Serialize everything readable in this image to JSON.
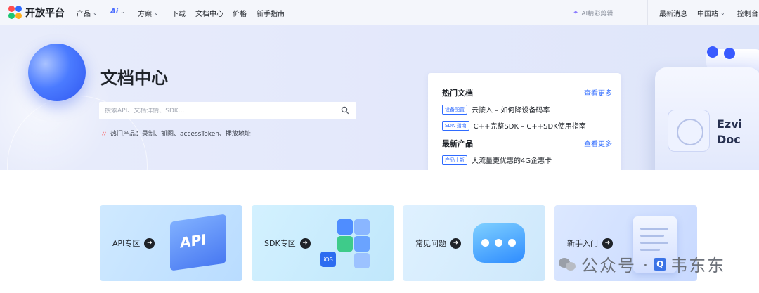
{
  "nav": {
    "logo": "开放平台",
    "items": [
      {
        "label": "产品",
        "has_dropdown": true
      },
      {
        "label": "Ai",
        "has_dropdown": true
      },
      {
        "label": "方案",
        "has_dropdown": true
      },
      {
        "label": "下载",
        "has_dropdown": false
      },
      {
        "label": "文档中心",
        "has_dropdown": false
      },
      {
        "label": "价格",
        "has_dropdown": false
      },
      {
        "label": "新手指南",
        "has_dropdown": false
      }
    ],
    "ai_search_placeholder": "AI精彩剪辑",
    "right_items": [
      {
        "label": "最新消息",
        "has_dropdown": false
      },
      {
        "label": "中国站",
        "has_dropdown": true
      },
      {
        "label": "控制台",
        "has_dropdown": false
      }
    ]
  },
  "hero": {
    "title": "文档中心",
    "search_placeholder": "搜索API、文档详情、SDK...",
    "hot_label": "热门产品：录制、抓图、accessToken、播放地址",
    "illustration_text_line1": "Ezvi",
    "illustration_text_line2": "Doc"
  },
  "popular": {
    "docs_title": "热门文档",
    "docs_more": "查看更多",
    "docs": [
      {
        "tag": "设备配置",
        "title": "云接入 – 如何降设备码率"
      },
      {
        "tag": "SDK 指南",
        "title": "C++完整SDK – C++SDK使用指南"
      }
    ],
    "products_title": "最新产品",
    "products_more": "查看更多",
    "products": [
      {
        "tag": "产品上新",
        "title": "大流量更优惠的4G企惠卡"
      }
    ]
  },
  "entries": [
    {
      "label": "API专区",
      "art_text": "API"
    },
    {
      "label": "SDK专区",
      "art_text": "iOS"
    },
    {
      "label": "常见问题"
    },
    {
      "label": "新手入门"
    }
  ],
  "watermark": {
    "text_left": "公众号 · ",
    "text_right": "韦东东"
  },
  "colors": {
    "accent": "#2f6bff",
    "hero_bg": "#e5e9fb",
    "text": "#1f2329"
  }
}
